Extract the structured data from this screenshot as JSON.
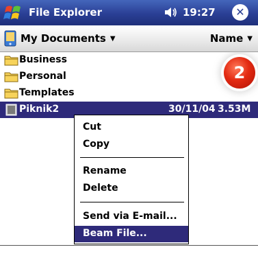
{
  "titlebar": {
    "app_title": "File Explorer",
    "time": "19:27",
    "start_icon": "windows-flag-icon",
    "close_icon": "close-icon",
    "volume_icon": "speaker-icon"
  },
  "toolbar": {
    "folder": "My Documents",
    "sort": "Name"
  },
  "files": [
    {
      "name": "Business",
      "type": "folder"
    },
    {
      "name": "Personal",
      "type": "folder"
    },
    {
      "name": "Templates",
      "type": "folder"
    },
    {
      "name": "Piknik2",
      "type": "file",
      "date": "30/11/04",
      "size": "3.53M",
      "selected": true
    }
  ],
  "badge": "2",
  "context_menu": {
    "items": [
      "Cut",
      "Copy",
      "Rename",
      "Delete",
      "Send via E-mail...",
      "Beam File..."
    ],
    "active": "Beam File..."
  },
  "colors": {
    "title_bar": "#2a3f95",
    "selection": "#2e2a7a",
    "badge": "#e32a12"
  }
}
